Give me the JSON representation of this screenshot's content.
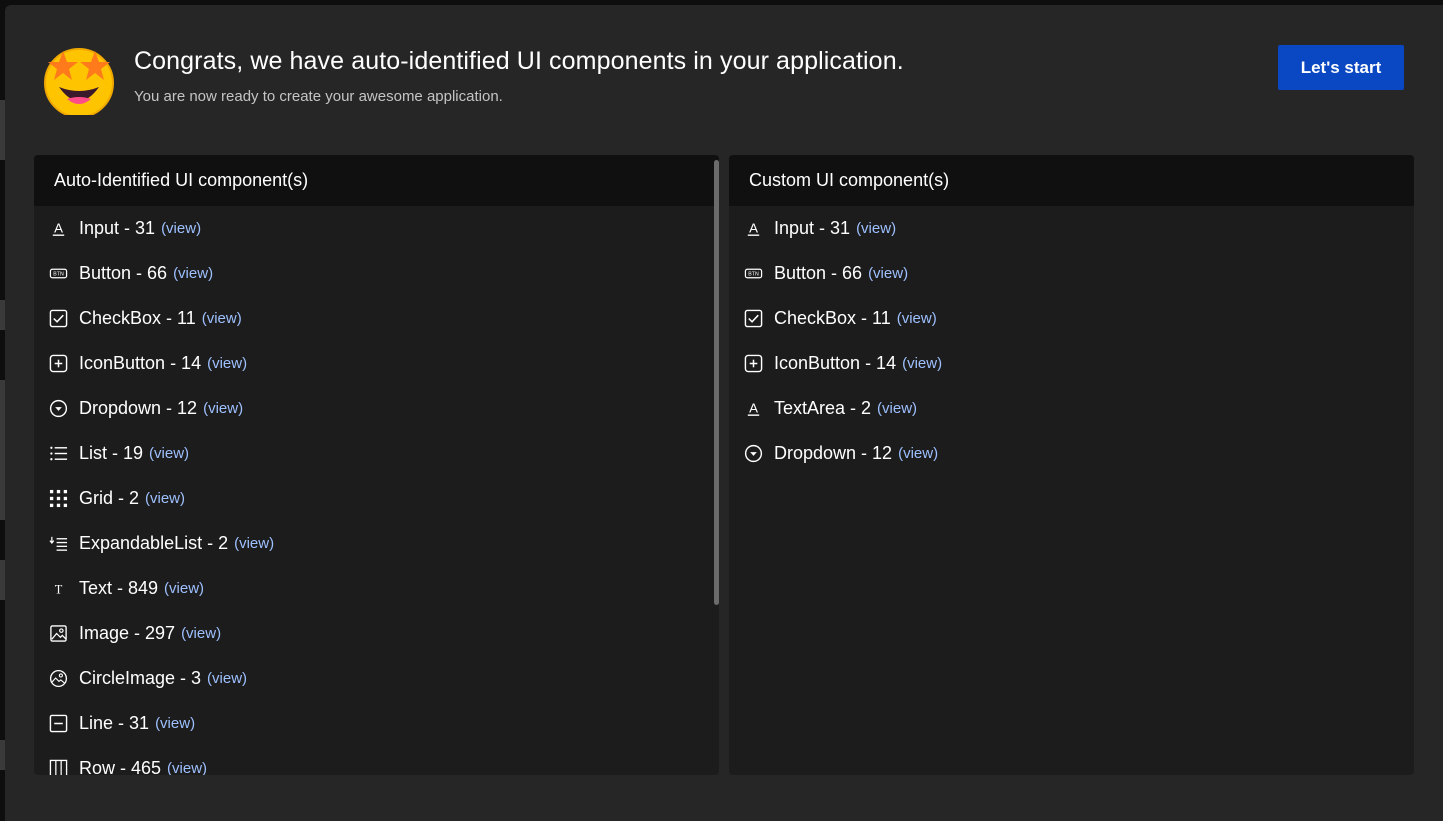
{
  "header": {
    "title": "Congrats, we have auto-identified UI components in your application.",
    "subtitle": "You are now ready to create your awesome application.",
    "start_label": "Let's start",
    "emoji": "star-struck-emoji-icon"
  },
  "colors": {
    "modal_bg": "#262626",
    "panel_bg": "#1c1c1c",
    "panel_header_bg": "#101010",
    "primary_button": "#0a47c2",
    "link": "#9ec0ff"
  },
  "auto_panel": {
    "title": "Auto-Identified UI component(s)",
    "items": [
      {
        "label": "Input - 31",
        "view": "(view)",
        "icon": "text-input-icon"
      },
      {
        "label": "Button - 66",
        "view": "(view)",
        "icon": "button-icon"
      },
      {
        "label": "CheckBox - 11",
        "view": "(view)",
        "icon": "checkbox-icon"
      },
      {
        "label": "IconButton - 14",
        "view": "(view)",
        "icon": "plus-box-icon"
      },
      {
        "label": "Dropdown - 12",
        "view": "(view)",
        "icon": "dropdown-circle-icon"
      },
      {
        "label": "List - 19",
        "view": "(view)",
        "icon": "list-icon"
      },
      {
        "label": "Grid - 2",
        "view": "(view)",
        "icon": "grid-icon"
      },
      {
        "label": "ExpandableList - 2",
        "view": "(view)",
        "icon": "expandable-list-icon"
      },
      {
        "label": "Text - 849",
        "view": "(view)",
        "icon": "text-icon"
      },
      {
        "label": "Image - 297",
        "view": "(view)",
        "icon": "image-icon"
      },
      {
        "label": "CircleImage - 3",
        "view": "(view)",
        "icon": "circle-image-icon"
      },
      {
        "label": "Line - 31",
        "view": "(view)",
        "icon": "line-icon"
      },
      {
        "label": "Row - 465",
        "view": "(view)",
        "icon": "row-icon"
      }
    ]
  },
  "custom_panel": {
    "title": "Custom UI component(s)",
    "items": [
      {
        "label": "Input - 31",
        "view": "(view)",
        "icon": "text-input-icon"
      },
      {
        "label": "Button - 66",
        "view": "(view)",
        "icon": "button-icon"
      },
      {
        "label": "CheckBox - 11",
        "view": "(view)",
        "icon": "checkbox-icon"
      },
      {
        "label": "IconButton - 14",
        "view": "(view)",
        "icon": "plus-box-icon"
      },
      {
        "label": "TextArea - 2",
        "view": "(view)",
        "icon": "text-input-icon"
      },
      {
        "label": "Dropdown - 12",
        "view": "(view)",
        "icon": "dropdown-circle-icon"
      }
    ]
  }
}
